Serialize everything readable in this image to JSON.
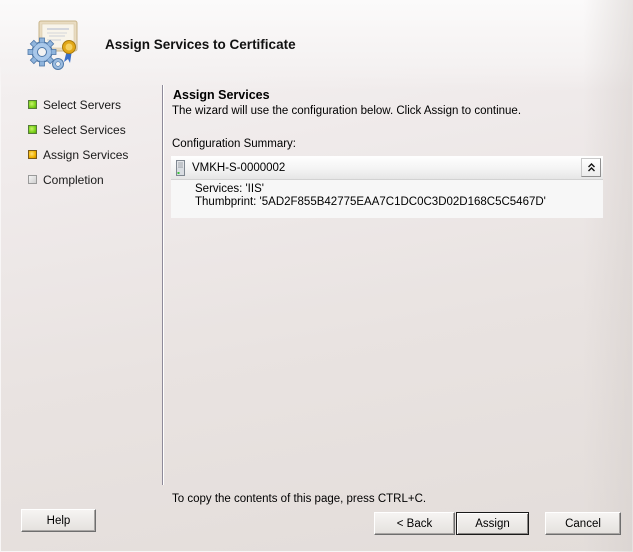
{
  "window": {
    "title": "Assign Services to Certificate",
    "header_icon": "certificate-gears-icon"
  },
  "steps": [
    {
      "label": "Select Servers",
      "status": "done",
      "color": "#7bd21a"
    },
    {
      "label": "Select Services",
      "status": "done",
      "color": "#7bd21a"
    },
    {
      "label": "Assign Services",
      "status": "current",
      "color": "#f2b400"
    },
    {
      "label": "Completion",
      "status": "pending",
      "color": "#cfcfcf"
    }
  ],
  "main": {
    "section_title": "Assign Services",
    "description": "The wizard will use the configuration below.  Click Assign to continue.",
    "config_label": "Configuration Summary:",
    "summary": {
      "server_icon": "server-icon",
      "server_name": "VMKH-S-0000002",
      "collapse_glyph": "⌃",
      "services_line": "Services: 'IIS'",
      "thumbprint_line": "Thumbprint: '5AD2F855B42775EAA7C1DC0C3D02D168C5C5467D'"
    },
    "copy_hint": "To copy the contents of this page, press CTRL+C."
  },
  "buttons": {
    "help": "Help",
    "back": "< Back",
    "assign": "Assign",
    "cancel": "Cancel"
  }
}
